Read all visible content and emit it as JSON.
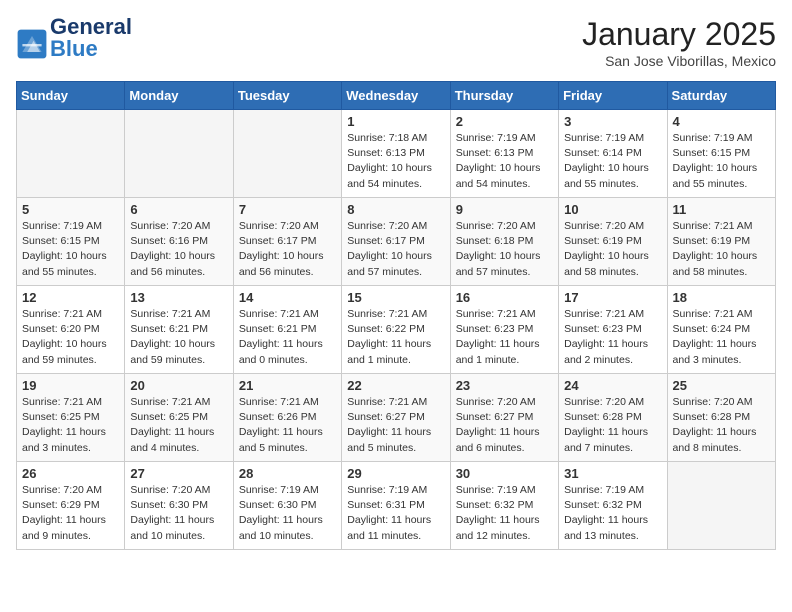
{
  "header": {
    "logo_general": "General",
    "logo_blue": "Blue",
    "month_title": "January 2025",
    "location": "San Jose Viborillas, Mexico"
  },
  "days_of_week": [
    "Sunday",
    "Monday",
    "Tuesday",
    "Wednesday",
    "Thursday",
    "Friday",
    "Saturday"
  ],
  "weeks": [
    [
      {
        "day": "",
        "info": ""
      },
      {
        "day": "",
        "info": ""
      },
      {
        "day": "",
        "info": ""
      },
      {
        "day": "1",
        "info": "Sunrise: 7:18 AM\nSunset: 6:13 PM\nDaylight: 10 hours\nand 54 minutes."
      },
      {
        "day": "2",
        "info": "Sunrise: 7:19 AM\nSunset: 6:13 PM\nDaylight: 10 hours\nand 54 minutes."
      },
      {
        "day": "3",
        "info": "Sunrise: 7:19 AM\nSunset: 6:14 PM\nDaylight: 10 hours\nand 55 minutes."
      },
      {
        "day": "4",
        "info": "Sunrise: 7:19 AM\nSunset: 6:15 PM\nDaylight: 10 hours\nand 55 minutes."
      }
    ],
    [
      {
        "day": "5",
        "info": "Sunrise: 7:19 AM\nSunset: 6:15 PM\nDaylight: 10 hours\nand 55 minutes."
      },
      {
        "day": "6",
        "info": "Sunrise: 7:20 AM\nSunset: 6:16 PM\nDaylight: 10 hours\nand 56 minutes."
      },
      {
        "day": "7",
        "info": "Sunrise: 7:20 AM\nSunset: 6:17 PM\nDaylight: 10 hours\nand 56 minutes."
      },
      {
        "day": "8",
        "info": "Sunrise: 7:20 AM\nSunset: 6:17 PM\nDaylight: 10 hours\nand 57 minutes."
      },
      {
        "day": "9",
        "info": "Sunrise: 7:20 AM\nSunset: 6:18 PM\nDaylight: 10 hours\nand 57 minutes."
      },
      {
        "day": "10",
        "info": "Sunrise: 7:20 AM\nSunset: 6:19 PM\nDaylight: 10 hours\nand 58 minutes."
      },
      {
        "day": "11",
        "info": "Sunrise: 7:21 AM\nSunset: 6:19 PM\nDaylight: 10 hours\nand 58 minutes."
      }
    ],
    [
      {
        "day": "12",
        "info": "Sunrise: 7:21 AM\nSunset: 6:20 PM\nDaylight: 10 hours\nand 59 minutes."
      },
      {
        "day": "13",
        "info": "Sunrise: 7:21 AM\nSunset: 6:21 PM\nDaylight: 10 hours\nand 59 minutes."
      },
      {
        "day": "14",
        "info": "Sunrise: 7:21 AM\nSunset: 6:21 PM\nDaylight: 11 hours\nand 0 minutes."
      },
      {
        "day": "15",
        "info": "Sunrise: 7:21 AM\nSunset: 6:22 PM\nDaylight: 11 hours\nand 1 minute."
      },
      {
        "day": "16",
        "info": "Sunrise: 7:21 AM\nSunset: 6:23 PM\nDaylight: 11 hours\nand 1 minute."
      },
      {
        "day": "17",
        "info": "Sunrise: 7:21 AM\nSunset: 6:23 PM\nDaylight: 11 hours\nand 2 minutes."
      },
      {
        "day": "18",
        "info": "Sunrise: 7:21 AM\nSunset: 6:24 PM\nDaylight: 11 hours\nand 3 minutes."
      }
    ],
    [
      {
        "day": "19",
        "info": "Sunrise: 7:21 AM\nSunset: 6:25 PM\nDaylight: 11 hours\nand 3 minutes."
      },
      {
        "day": "20",
        "info": "Sunrise: 7:21 AM\nSunset: 6:25 PM\nDaylight: 11 hours\nand 4 minutes."
      },
      {
        "day": "21",
        "info": "Sunrise: 7:21 AM\nSunset: 6:26 PM\nDaylight: 11 hours\nand 5 minutes."
      },
      {
        "day": "22",
        "info": "Sunrise: 7:21 AM\nSunset: 6:27 PM\nDaylight: 11 hours\nand 5 minutes."
      },
      {
        "day": "23",
        "info": "Sunrise: 7:20 AM\nSunset: 6:27 PM\nDaylight: 11 hours\nand 6 minutes."
      },
      {
        "day": "24",
        "info": "Sunrise: 7:20 AM\nSunset: 6:28 PM\nDaylight: 11 hours\nand 7 minutes."
      },
      {
        "day": "25",
        "info": "Sunrise: 7:20 AM\nSunset: 6:28 PM\nDaylight: 11 hours\nand 8 minutes."
      }
    ],
    [
      {
        "day": "26",
        "info": "Sunrise: 7:20 AM\nSunset: 6:29 PM\nDaylight: 11 hours\nand 9 minutes."
      },
      {
        "day": "27",
        "info": "Sunrise: 7:20 AM\nSunset: 6:30 PM\nDaylight: 11 hours\nand 10 minutes."
      },
      {
        "day": "28",
        "info": "Sunrise: 7:19 AM\nSunset: 6:30 PM\nDaylight: 11 hours\nand 10 minutes."
      },
      {
        "day": "29",
        "info": "Sunrise: 7:19 AM\nSunset: 6:31 PM\nDaylight: 11 hours\nand 11 minutes."
      },
      {
        "day": "30",
        "info": "Sunrise: 7:19 AM\nSunset: 6:32 PM\nDaylight: 11 hours\nand 12 minutes."
      },
      {
        "day": "31",
        "info": "Sunrise: 7:19 AM\nSunset: 6:32 PM\nDaylight: 11 hours\nand 13 minutes."
      },
      {
        "day": "",
        "info": ""
      }
    ]
  ]
}
